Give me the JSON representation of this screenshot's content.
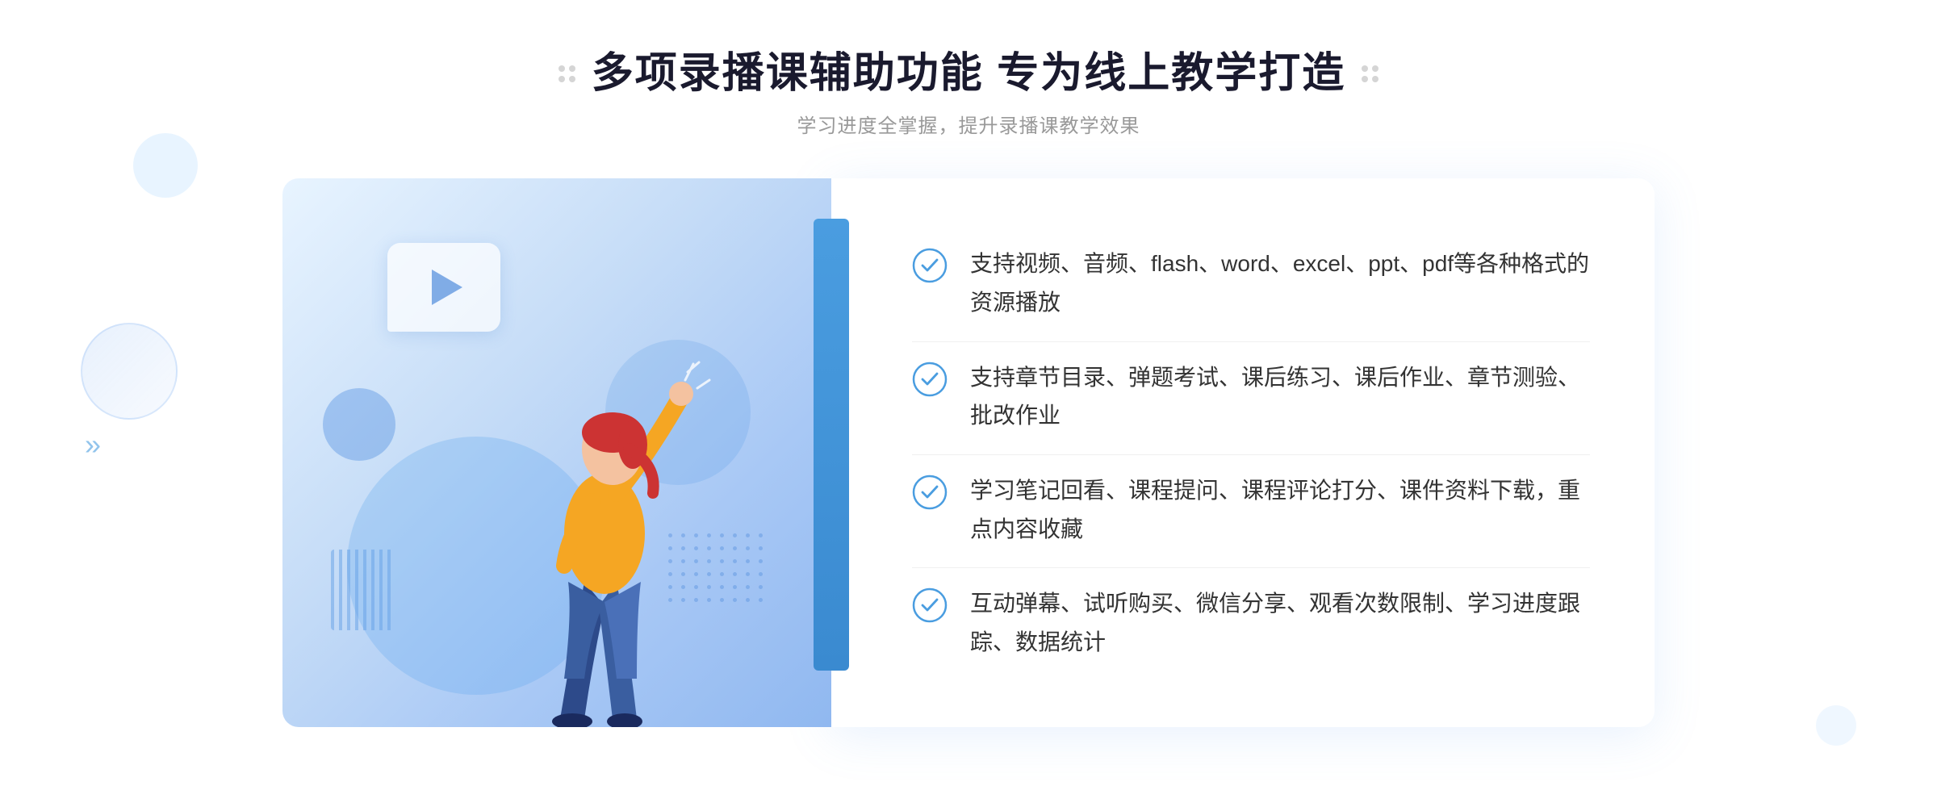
{
  "header": {
    "title": "多项录播课辅助功能 专为线上教学打造",
    "subtitle": "学习进度全掌握，提升录播课教学效果"
  },
  "features": [
    {
      "id": "feature-1",
      "text": "支持视频、音频、flash、word、excel、ppt、pdf等各种格式的资源播放"
    },
    {
      "id": "feature-2",
      "text": "支持章节目录、弹题考试、课后练习、课后作业、章节测验、批改作业"
    },
    {
      "id": "feature-3",
      "text": "学习笔记回看、课程提问、课程评论打分、课件资料下载，重点内容收藏"
    },
    {
      "id": "feature-4",
      "text": "互动弹幕、试听购买、微信分享、观看次数限制、学习进度跟踪、数据统计"
    }
  ],
  "decorations": {
    "arrow_symbol": "»",
    "play_icon": "▶"
  }
}
